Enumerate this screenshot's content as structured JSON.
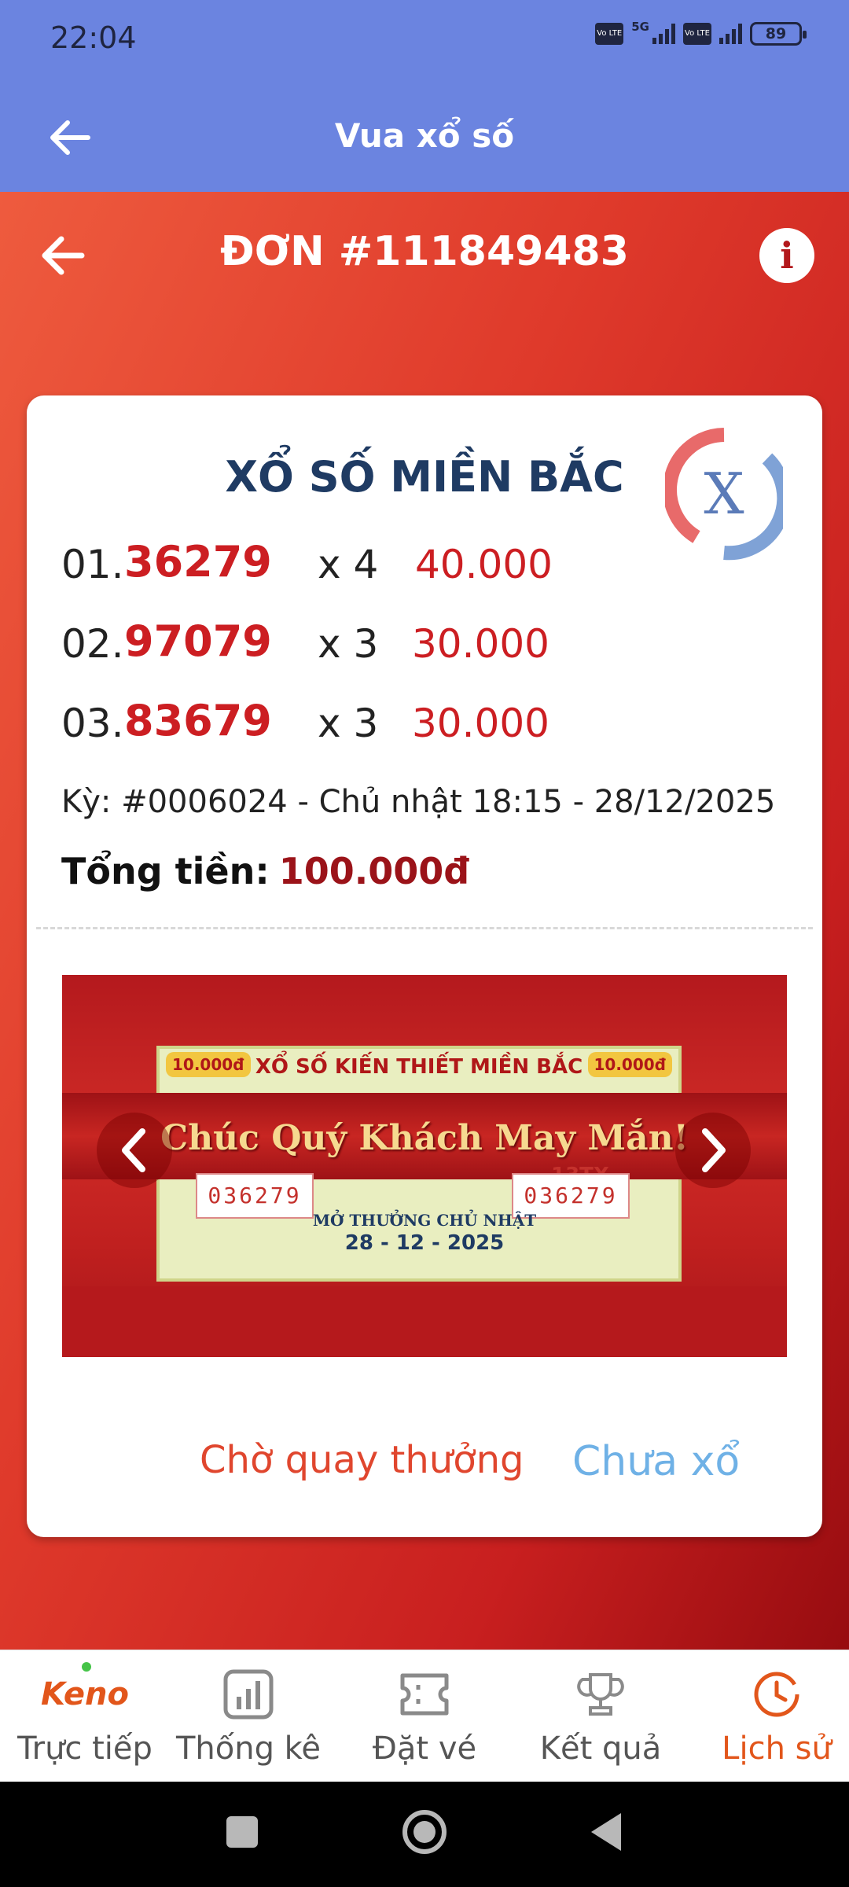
{
  "status_bar": {
    "time": "22:04",
    "network": "5G",
    "volte": "Vo LTE",
    "battery": "89"
  },
  "app_bar": {
    "title": "Vua xổ số"
  },
  "order": {
    "title": "ĐƠN #111849483",
    "info_icon": "i"
  },
  "ticket": {
    "lottery_name": "XỔ SỐ MIỀN BẮC",
    "logo_letter": "X",
    "lines": [
      {
        "index": "01.",
        "number": "36279",
        "multiplier": "x 4",
        "amount": "40.000"
      },
      {
        "index": "02.",
        "number": "97079",
        "multiplier": "x 3",
        "amount": "30.000"
      },
      {
        "index": "03.",
        "number": "83679",
        "multiplier": "x 3",
        "amount": "30.000"
      }
    ],
    "period": "Kỳ: #0006024 - Chủ nhật 18:15 - 28/12/2025",
    "total_label": "Tổng tiền:",
    "total_value": "100.000đ"
  },
  "banner": {
    "ticket_title": "XỔ SỐ KIẾN THIẾT MIỀN BẮC",
    "ticket_price": "10.000đ",
    "greeting": "Chúc Quý Khách May Mắn!",
    "ticket_number": "036279",
    "ticket_code": "13TX",
    "draw_day": "MỞ THƯỞNG CHỦ NHẬT",
    "draw_date": "28 - 12 - 2025"
  },
  "status": {
    "waiting": "Chờ quay thưởng",
    "result": "Chưa xổ"
  },
  "bottom_nav": [
    {
      "icon": "keno-icon",
      "icon_text": "Keno",
      "label": "Trực tiếp",
      "active": false
    },
    {
      "icon": "chart-icon",
      "label": "Thống kê",
      "active": false
    },
    {
      "icon": "ticket-icon",
      "label": "Đặt vé",
      "active": false
    },
    {
      "icon": "trophy-icon",
      "label": "Kết quả",
      "active": false
    },
    {
      "icon": "clock-icon",
      "label": "Lịch sử",
      "active": true
    }
  ],
  "colors": {
    "app_bar": "#6b84e0",
    "red_primary": "#cc1e22",
    "active_tab": "#e2561b",
    "undrawn": "#6fb1e6"
  }
}
